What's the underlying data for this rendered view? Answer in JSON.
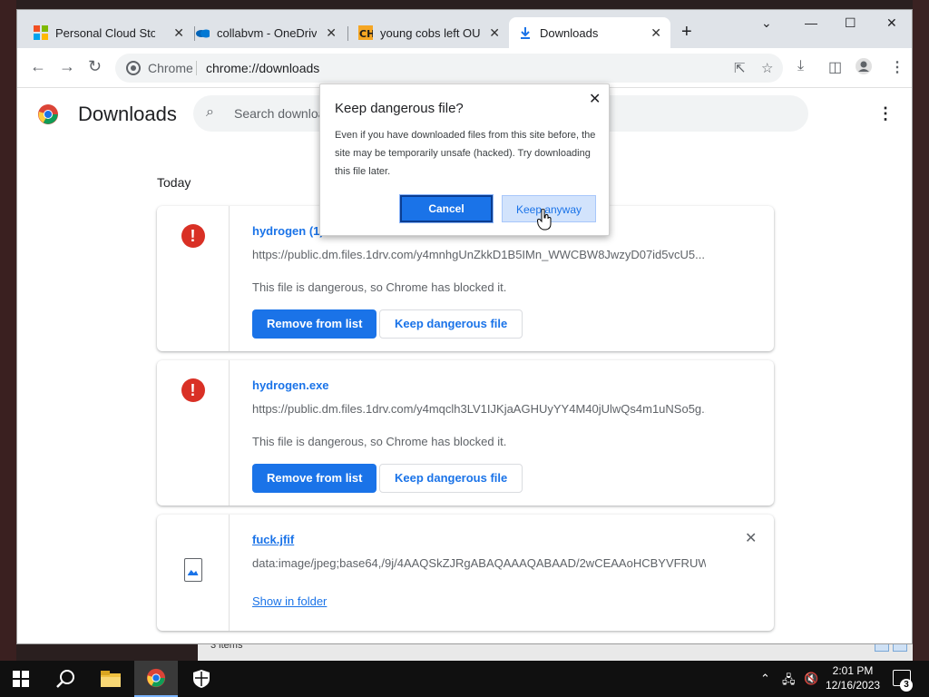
{
  "browser": {
    "tabs": [
      {
        "title": "Personal Cloud Storage",
        "icon": "microsoft-icon"
      },
      {
        "title": "collabvm - OneDrive",
        "icon": "onedrive-icon"
      },
      {
        "title": "young cobs left OUTSIDE",
        "icon": "ch-icon"
      },
      {
        "title": "Downloads",
        "icon": "download-icon"
      }
    ],
    "active_tab": 3,
    "new_tab_label": "+",
    "omnibox": {
      "site_label": "Chrome",
      "url": "chrome://downloads"
    }
  },
  "downloads_page": {
    "title": "Downloads",
    "search_placeholder": "Search downloads",
    "section": "Today",
    "items": [
      {
        "name": "hydrogen (1).exe",
        "url": "https://public.dm.files.1drv.com/y4mnhgUnZkkD1B5IMn_WWCBW8JwzyD07id5vcU5...",
        "status": "This file is dangerous, so Chrome has blocked it.",
        "primary_button": "Remove from list",
        "secondary_button": "Keep dangerous file"
      },
      {
        "name": "hydrogen.exe",
        "url": "https://public.dm.files.1drv.com/y4mqclh3LV1IJKjaAGHUyYY4M40jUlwQs4m1uNSo5g...",
        "status": "This file is dangerous, so Chrome has blocked it.",
        "primary_button": "Remove from list",
        "secondary_button": "Keep dangerous file"
      },
      {
        "name": "fuck.jfif",
        "url": "data:image/jpeg;base64,/9j/4AAQSkZJRgABAQAAAQABAAD/2wCEAAoHCBYVFRUWF...",
        "link": "Show in folder"
      }
    ]
  },
  "dialog": {
    "title": "Keep dangerous file?",
    "body": "Even if you have downloaded files from this site before, the site may be temporarily unsafe (hacked). Try downloading this file later.",
    "cancel_label": "Cancel",
    "keep_label": "Keep anyway"
  },
  "background_window": {
    "status": "3 items"
  },
  "taskbar": {
    "time": "2:01 PM",
    "date": "12/16/2023",
    "notification_count": "3"
  },
  "colors": {
    "accent": "#1a73e8",
    "danger": "#d93025"
  }
}
